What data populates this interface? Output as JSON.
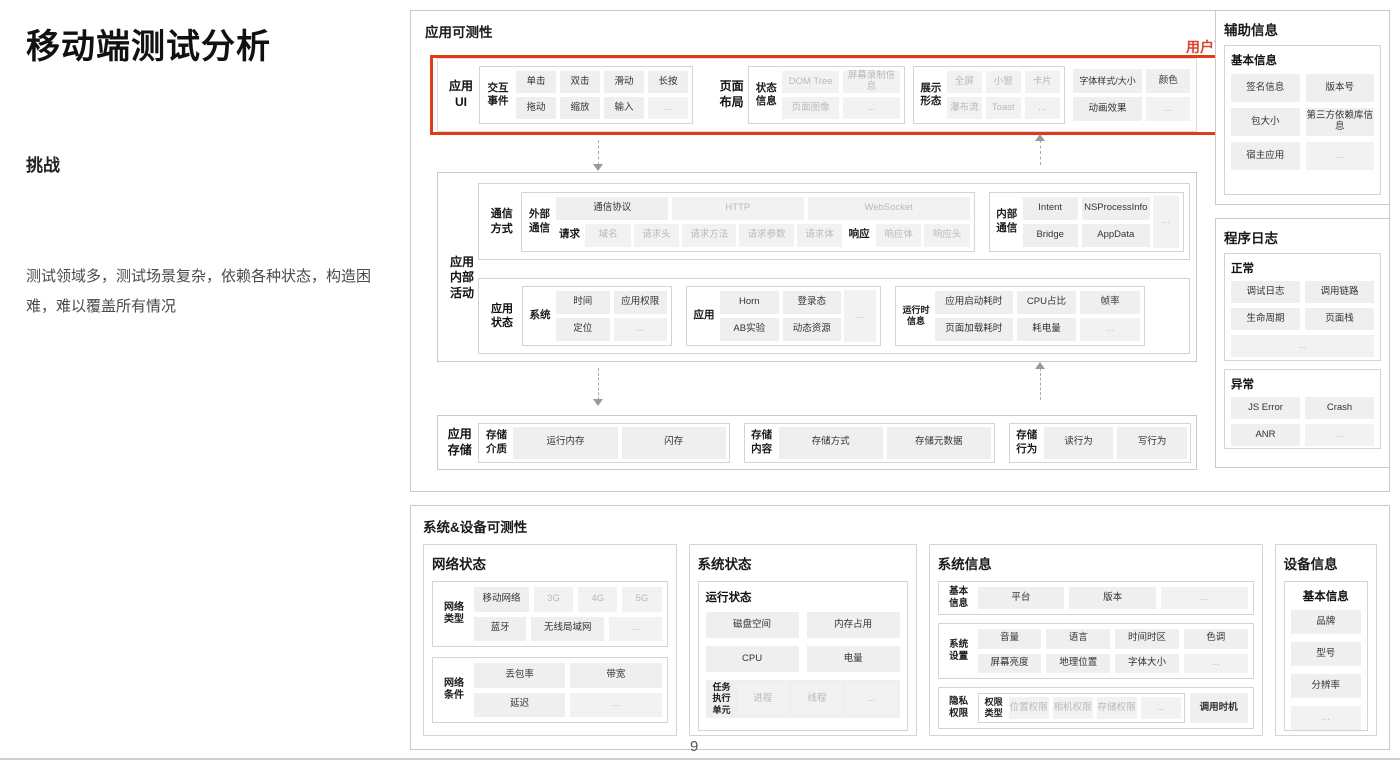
{
  "slide": {
    "title": "移动端测试分析",
    "challenge_heading": "挑战",
    "challenge_body": "测试领域多，测试场景复杂，依赖各种状态，构造困难，难以覆盖所有情况",
    "page_number": "9",
    "accent_red": "#d9452a",
    "chip_bg": "#efefef"
  },
  "app_testability": {
    "title": "应用可测性",
    "user_observable_label": "用户可观",
    "app_ui": {
      "label": "应用\nUI",
      "interaction": {
        "label": "交互\n事件",
        "items": [
          "单击",
          "双击",
          "滑动",
          "长按",
          "拖动",
          "缩放",
          "输入",
          "..."
        ]
      }
    },
    "page_layout": {
      "label": "页面\n布局",
      "state_info": {
        "label": "状态\n信息",
        "items": [
          "DOM Tree",
          "屏幕录制信息",
          "页面图像",
          "..."
        ]
      },
      "display_form": {
        "label": "展示\n形态",
        "items": [
          "全屏",
          "小窗",
          "卡片",
          "瀑布流",
          "Toast",
          "..."
        ]
      },
      "style_items": [
        "字体样式/大小",
        "颜色",
        "动画效果",
        "..."
      ]
    },
    "app_internal": {
      "label": "应用\n内部\n活动",
      "comm_method": {
        "label": "通信\n方式",
        "external": {
          "label": "外部\n通信",
          "protocol_label": "通信协议",
          "protocols": [
            "HTTP",
            "WebSocket"
          ],
          "request_label": "请求",
          "request_items": [
            "域名",
            "请求头",
            "请求方法",
            "请求参数",
            "请求体"
          ],
          "response_label": "响应",
          "response_items": [
            "响应体",
            "响应头"
          ]
        },
        "internal": {
          "label": "内部\n通信",
          "items": [
            "Intent",
            "NSProcessInfo",
            "Bridge",
            "AppData",
            "..."
          ]
        }
      },
      "app_state": {
        "label": "应用\n状态",
        "system": {
          "label": "系统",
          "items": [
            "时间",
            "应用权限",
            "定位",
            "..."
          ]
        },
        "application": {
          "label": "应用",
          "items": [
            "Horn",
            "登录态",
            "AB实验",
            "动态资源",
            "..."
          ]
        },
        "runtime": {
          "label": "运行时\n信息",
          "items": [
            "应用启动耗时",
            "CPU占比",
            "帧率",
            "页面加载耗时",
            "耗电量",
            "..."
          ]
        }
      }
    },
    "app_storage": {
      "label": "应用\n存储",
      "medium": {
        "label": "存储\n介质",
        "items": [
          "运行内存",
          "闪存"
        ]
      },
      "content": {
        "label": "存储\n内容",
        "items": [
          "存储方式",
          "存储元数据"
        ]
      },
      "behavior": {
        "label": "存储\n行为",
        "items": [
          "读行为",
          "写行为"
        ]
      }
    }
  },
  "aux_info": {
    "title": "辅助信息",
    "basic": {
      "label": "基本信息",
      "items": [
        "签名信息",
        "版本号",
        "包大小",
        "第三方依赖库信息",
        "宿主应用",
        "..."
      ]
    }
  },
  "program_log": {
    "title": "程序日志",
    "normal": {
      "label": "正常",
      "items": [
        "调试日志",
        "调用链路",
        "生命周期",
        "页面栈",
        "..."
      ]
    },
    "abnormal": {
      "label": "异常",
      "items": [
        "JS Error",
        "Crash",
        "ANR",
        "..."
      ]
    }
  },
  "system_device": {
    "title": "系统&设备可测性",
    "network_state": {
      "title": "网络状态",
      "net_type": {
        "label": "网络\n类型",
        "mobile_label": "移动网络",
        "generations": [
          "3G",
          "4G",
          "5G"
        ],
        "items": [
          "蓝牙",
          "无线局域网",
          "..."
        ]
      },
      "net_condition": {
        "label": "网络\n条件",
        "items": [
          "丢包率",
          "带宽",
          "延迟",
          "..."
        ]
      }
    },
    "system_state": {
      "title": "系统状态",
      "running": {
        "label": "运行状态",
        "items": [
          "磁盘空间",
          "内存占用",
          "CPU",
          "电量"
        ],
        "task_unit": {
          "label": "任务\n执行\n单元",
          "items": [
            "进程",
            "线程",
            "..."
          ]
        }
      }
    },
    "system_info": {
      "title": "系统信息",
      "basic": {
        "label": "基本\n信息",
        "items": [
          "平台",
          "版本",
          "..."
        ]
      },
      "settings": {
        "label": "系统\n设置",
        "items": [
          "音量",
          "语言",
          "时间时区",
          "色调",
          "屏幕亮度",
          "地理位置",
          "字体大小",
          "..."
        ]
      },
      "privacy": {
        "label": "隐私\n权限",
        "perm_type_label": "权限\n类型",
        "perm_items": [
          "位置权限",
          "相机权限",
          "存储权限",
          "..."
        ],
        "timing_label": "调用时机"
      }
    },
    "device_info": {
      "title": "设备信息",
      "basic": {
        "label": "基本信息",
        "items": [
          "品牌",
          "型号",
          "分辨率",
          "..."
        ]
      }
    }
  }
}
